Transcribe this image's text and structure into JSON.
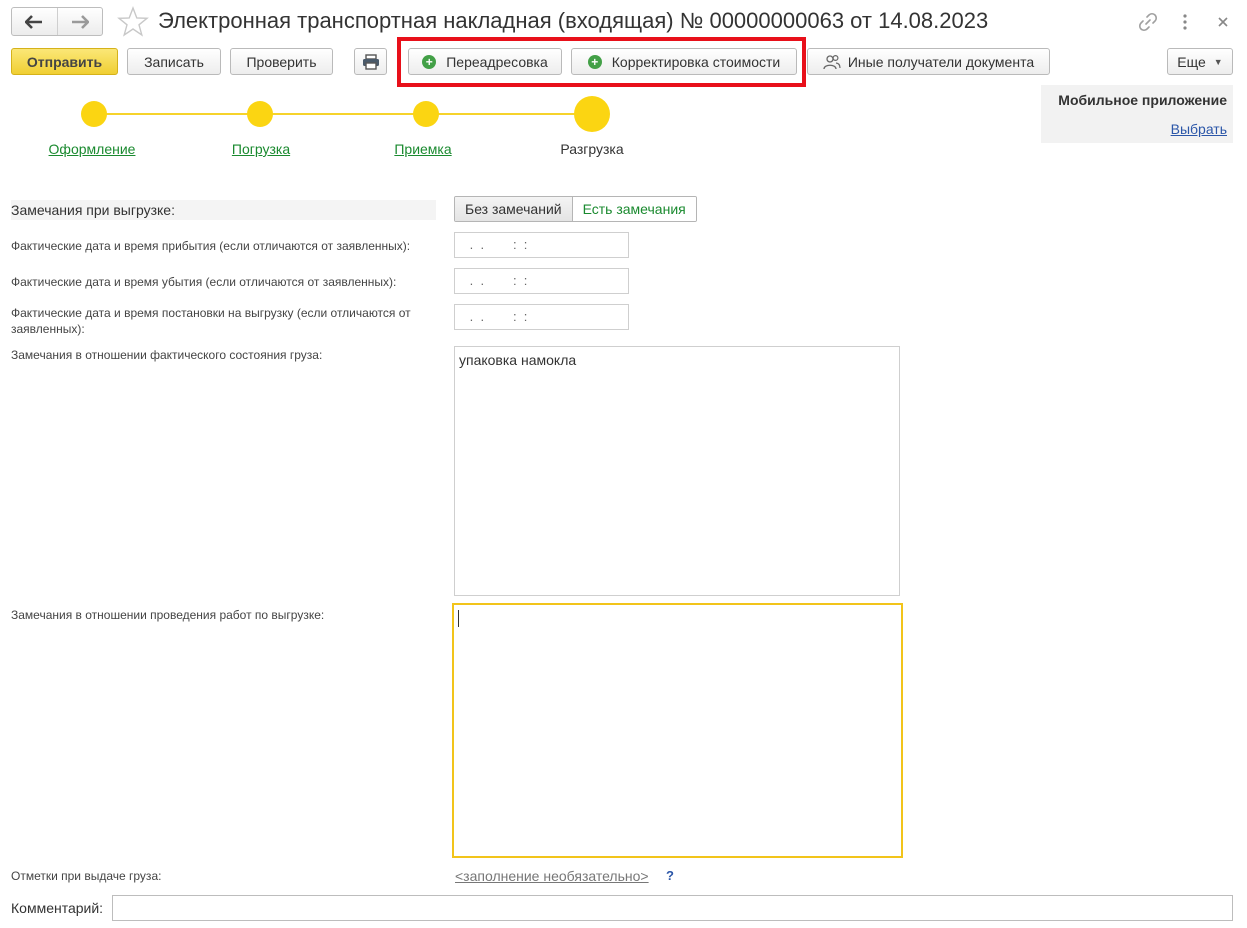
{
  "window": {
    "title": "Электронная транспортная накладная (входящая) № 00000000063 от 14.08.2023"
  },
  "icons": {
    "back": "arrow-left-icon",
    "forward": "arrow-right-icon",
    "favorite": "star-icon",
    "link": "link-icon",
    "more": "kebab-menu-icon",
    "close": "close-icon",
    "print": "printer-icon",
    "add": "plus-circle-icon",
    "recipients": "users-icon",
    "dropdown": "caret-down-icon"
  },
  "toolbar": {
    "send_label": "Отправить",
    "save_label": "Записать",
    "check_label": "Проверить",
    "readdress_label": "Переадресовка",
    "cost_correction_label": "Корректировка стоимости",
    "other_recipients_label": "Иные получатели документа",
    "more_label": "Еще"
  },
  "mobile_app": {
    "title": "Мобильное приложение",
    "select_link": "Выбрать"
  },
  "progress": {
    "steps": [
      {
        "label": "Оформление",
        "state": "done"
      },
      {
        "label": "Погрузка",
        "state": "done"
      },
      {
        "label": "Приемка",
        "state": "done"
      },
      {
        "label": "Разгрузка",
        "state": "current"
      }
    ]
  },
  "form": {
    "remarks_label": "Замечания при выгрузке:",
    "remarks_options": [
      "Без замечаний",
      "Есть замечания"
    ],
    "remarks_selected": "Есть замечания",
    "arrival_label": "Фактические дата и время прибытия (если отличаются от заявленных):",
    "arrival_value": " .  .        :  :",
    "departure_label": "Фактические дата и время убытия (если отличаются от заявленных):",
    "departure_value": " .  .        :  :",
    "unloading_start_label": "Фактические дата и время постановки на выгрузку (если отличаются от заявленных):",
    "unloading_start_value": " .  .        :  :",
    "cargo_state_label": "Замечания в отношении фактического состояния груза:",
    "cargo_state_value": "упаковка намокла",
    "unloading_works_label": "Замечания в отношении проведения работ по выгрузке:",
    "unloading_works_value": "",
    "issue_marks_label": "Отметки при выдаче груза:",
    "issue_marks_link": "<заполнение необязательно>",
    "help_mark": "?",
    "comment_label": "Комментарий:",
    "comment_value": ""
  },
  "colors": {
    "accent_yellow": "#fbd512",
    "link_green": "#1a8a2f",
    "link_blue": "#2b56a8",
    "highlight_red": "#e8101a"
  }
}
